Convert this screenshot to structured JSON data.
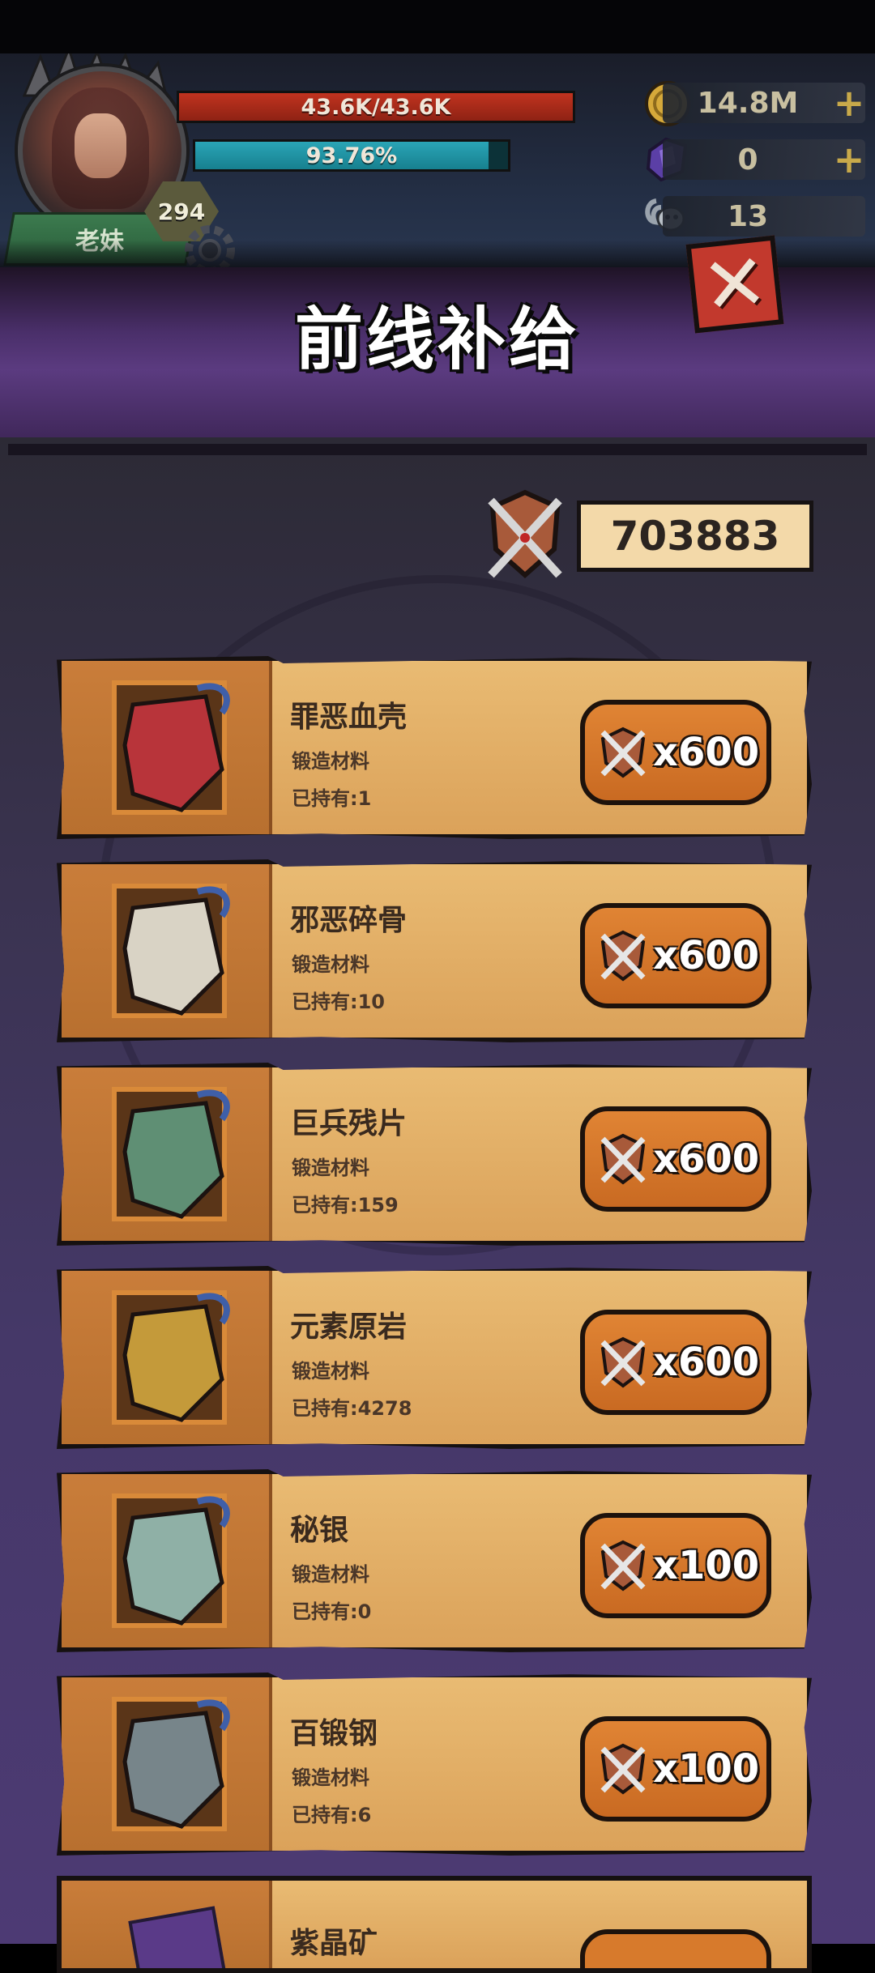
{
  "player": {
    "level": "294",
    "name": "老妹",
    "hp_text": "43.6K/43.6K",
    "hp_fraction": 1.0,
    "xp_text": "93.76%",
    "xp_fraction": 0.9376
  },
  "resources": {
    "gold": "14.8M",
    "gems": "0",
    "keys": "13"
  },
  "page": {
    "title": "前线补给",
    "close_icon": "close-icon"
  },
  "currency": {
    "amount": "703883",
    "icon": "crossed-swords-shield-icon"
  },
  "items": [
    {
      "name": "罪恶血壳",
      "type": "锻造材料",
      "owned": "已持有:1",
      "price": "x600",
      "icon": "red-shell-icon",
      "color": "#b8343a"
    },
    {
      "name": "邪恶碎骨",
      "type": "锻造材料",
      "owned": "已持有:10",
      "price": "x600",
      "icon": "bone-icon",
      "color": "#d9d3c5"
    },
    {
      "name": "巨兵残片",
      "type": "锻造材料",
      "owned": "已持有:159",
      "price": "x600",
      "icon": "green-shard-icon",
      "color": "#5f8f74"
    },
    {
      "name": "元素原岩",
      "type": "锻造材料",
      "owned": "已持有:4278",
      "price": "x600",
      "icon": "element-rock-icon",
      "color": "#c49a3a"
    },
    {
      "name": "秘银",
      "type": "锻造材料",
      "owned": "已持有:0",
      "price": "x100",
      "icon": "mithril-ingot-icon",
      "color": "#8fb0a6"
    },
    {
      "name": "百锻钢",
      "type": "锻造材料",
      "owned": "已持有:6",
      "price": "x100",
      "icon": "steel-ingot-icon",
      "color": "#77858a"
    }
  ],
  "partial_item": {
    "name": "紫晶矿",
    "icon": "purple-ore-icon"
  }
}
